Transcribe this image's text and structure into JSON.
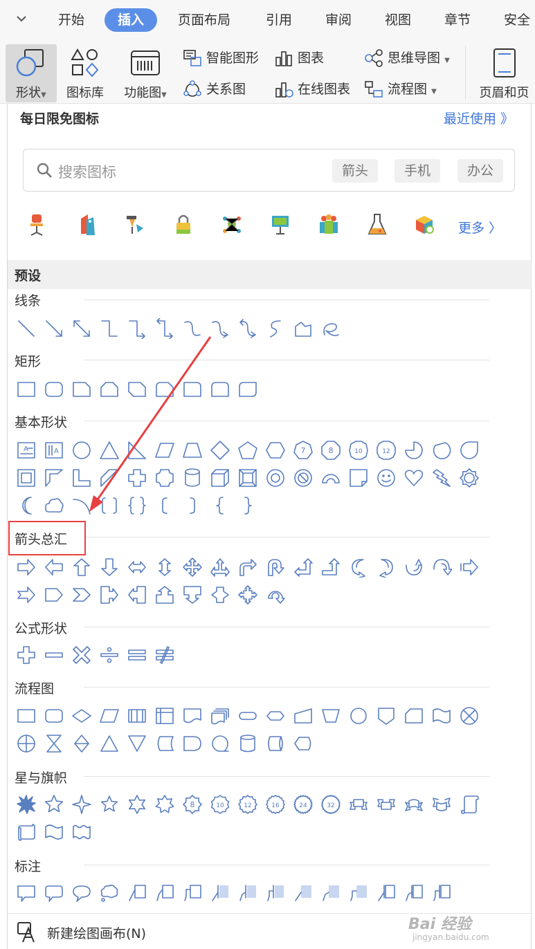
{
  "menu": {
    "items": [
      {
        "label": "开始"
      },
      {
        "label": "插入"
      },
      {
        "label": "页面布局"
      },
      {
        "label": "引用"
      },
      {
        "label": "审阅"
      },
      {
        "label": "视图"
      },
      {
        "label": "章节"
      },
      {
        "label": "安全"
      }
    ],
    "active": "插入"
  },
  "ribbon": {
    "shape": "形状",
    "icon_lib": "图标库",
    "function_chart": "功能图",
    "smart_art": "智能图形",
    "chart": "图表",
    "mind_map": "思维导图",
    "relation": "关系图",
    "online_chart": "在线图表",
    "flowchart": "流程图",
    "header_footer": "页眉和页"
  },
  "panel": {
    "title": "每日限免图标",
    "recent": "最近使用 》",
    "search_placeholder": "搜索图标",
    "chips": [
      "箭头",
      "手机",
      "办公"
    ],
    "more": "更多 〉",
    "preset": "预设",
    "new_canvas": "新建绘图画布(N)",
    "accent_color": "#3f76d8",
    "shape_stroke_color": "#5a7fbf"
  },
  "sections": [
    {
      "label": "线条"
    },
    {
      "label": "矩形"
    },
    {
      "label": "基本形状"
    },
    {
      "label": "箭头总汇"
    },
    {
      "label": "公式形状"
    },
    {
      "label": "流程图"
    },
    {
      "label": "星与旗帜"
    },
    {
      "label": "标注"
    }
  ],
  "shape_texts": {
    "n7": "7",
    "n8": "8",
    "n10": "10",
    "n12": "12",
    "s8": "8",
    "s10": "10",
    "s12": "12",
    "s16": "16",
    "s24": "24",
    "s32": "32"
  },
  "watermark": {
    "text": "Bai 经验",
    "sub": "jingyan.baidu.com"
  }
}
